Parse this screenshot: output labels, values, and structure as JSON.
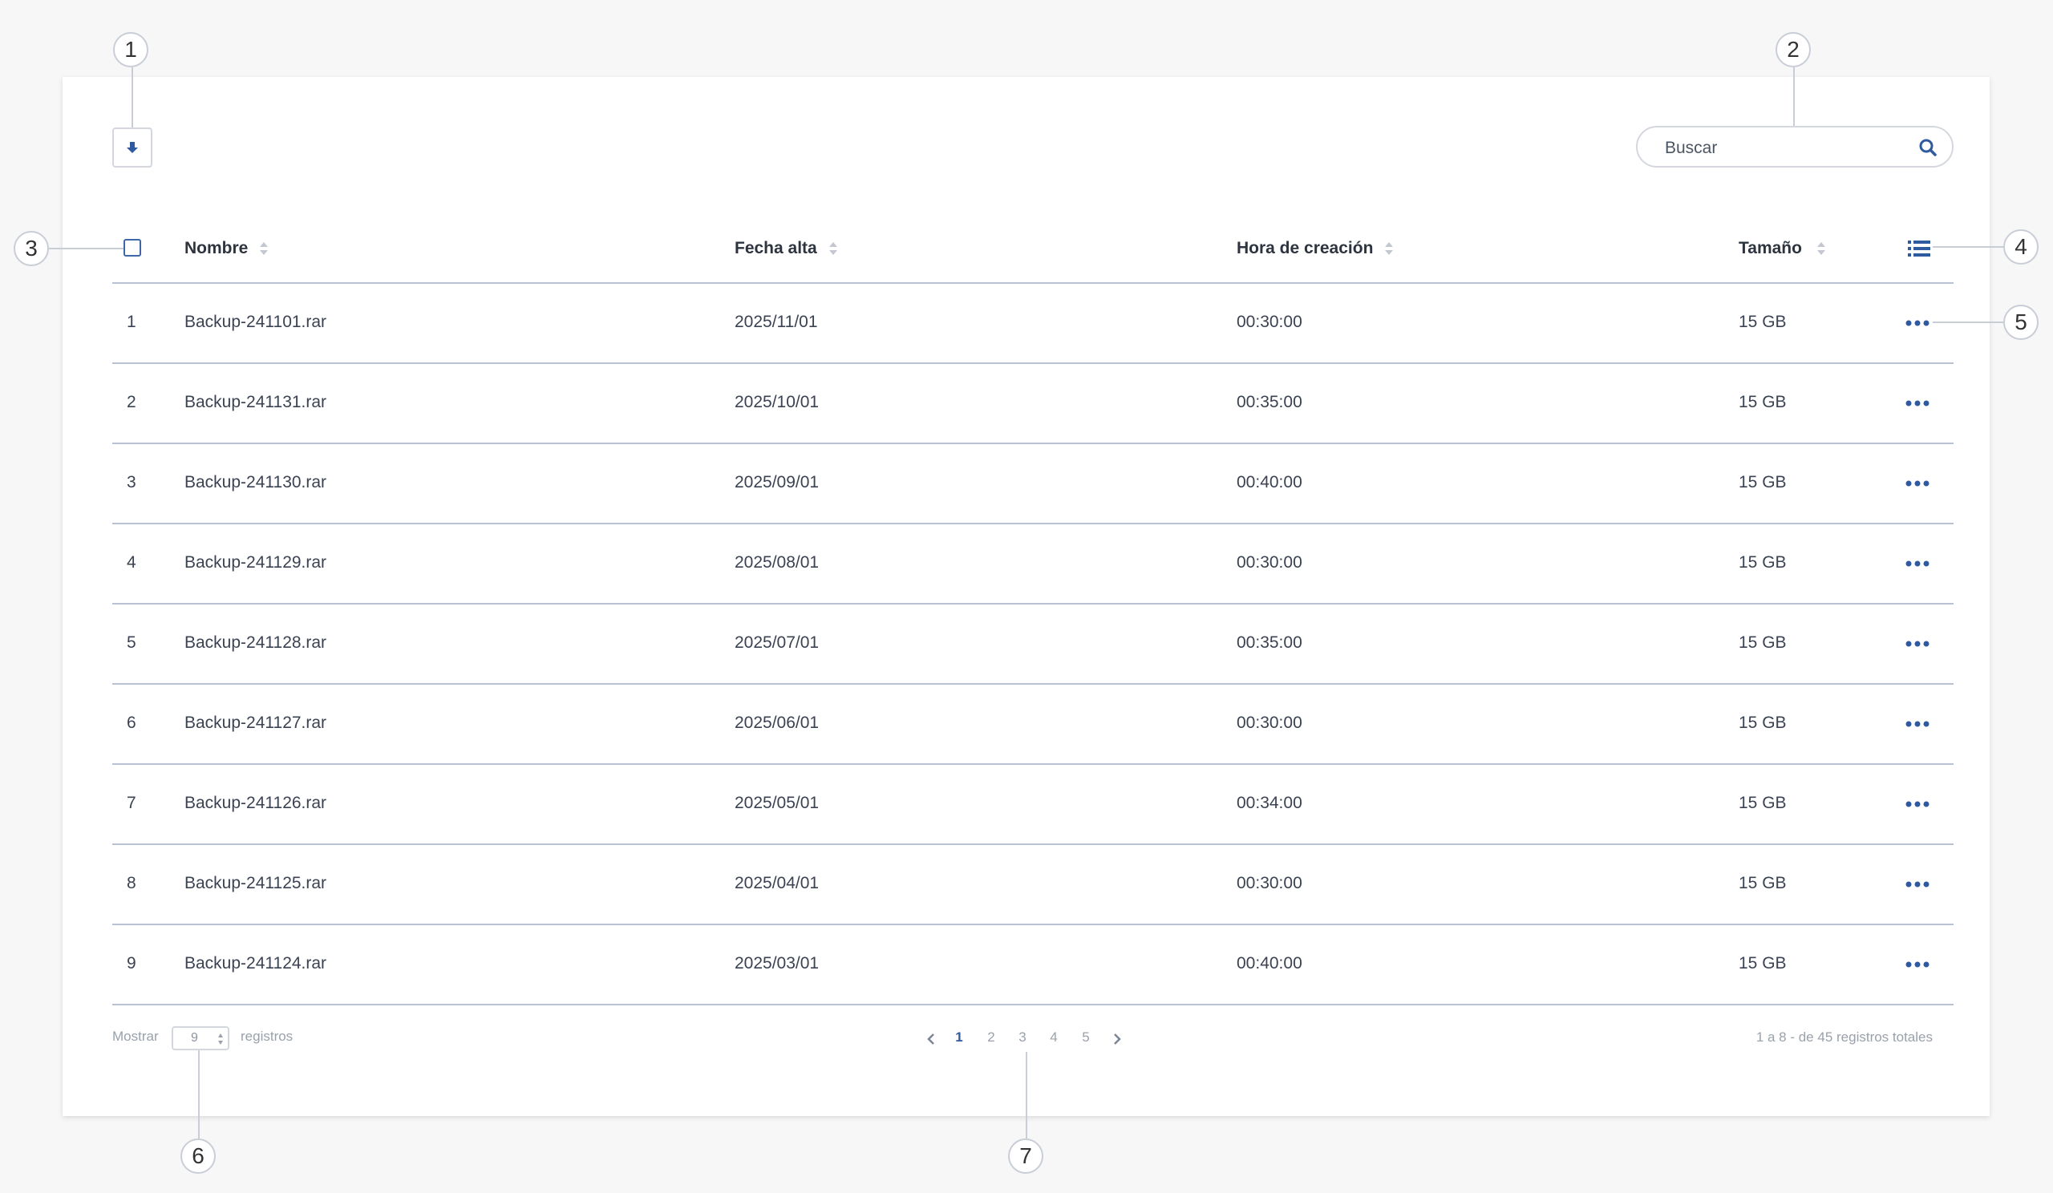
{
  "toolbar": {
    "download_icon": "download-icon",
    "search": {
      "placeholder": "Buscar",
      "icon": "search-icon"
    }
  },
  "table": {
    "columns": [
      "Nombre",
      "Fecha alta",
      "Hora de creación",
      "Tamaño"
    ],
    "rows": [
      {
        "num": "1",
        "name": "Backup-241101.rar",
        "date": "2025/11/01",
        "time": "00:30:00",
        "size": "15 GB"
      },
      {
        "num": "2",
        "name": "Backup-241131.rar",
        "date": "2025/10/01",
        "time": "00:35:00",
        "size": "15 GB"
      },
      {
        "num": "3",
        "name": "Backup-241130.rar",
        "date": "2025/09/01",
        "time": "00:40:00",
        "size": "15 GB"
      },
      {
        "num": "4",
        "name": "Backup-241129.rar",
        "date": "2025/08/01",
        "time": "00:30:00",
        "size": "15 GB"
      },
      {
        "num": "5",
        "name": "Backup-241128.rar",
        "date": "2025/07/01",
        "time": "00:35:00",
        "size": "15 GB"
      },
      {
        "num": "6",
        "name": "Backup-241127.rar",
        "date": "2025/06/01",
        "time": "00:30:00",
        "size": "15 GB"
      },
      {
        "num": "7",
        "name": "Backup-241126.rar",
        "date": "2025/05/01",
        "time": "00:34:00",
        "size": "15 GB"
      },
      {
        "num": "8",
        "name": "Backup-241125.rar",
        "date": "2025/04/01",
        "time": "00:30:00",
        "size": "15 GB"
      },
      {
        "num": "9",
        "name": "Backup-241124.rar",
        "date": "2025/03/01",
        "time": "00:40:00",
        "size": "15 GB"
      }
    ]
  },
  "footer": {
    "show_label": "Mostrar",
    "show_value": "9",
    "records_label": "registros",
    "pages": [
      "1",
      "2",
      "3",
      "4",
      "5"
    ],
    "active_page": "1",
    "total_text": "1 a 8 - de 45 registros totales"
  },
  "callouts": [
    "1",
    "2",
    "3",
    "4",
    "5",
    "6",
    "7"
  ],
  "colors": {
    "accent": "#2f5aa0",
    "divider": "#b9c2d3",
    "muted": "#9aa1ab"
  }
}
